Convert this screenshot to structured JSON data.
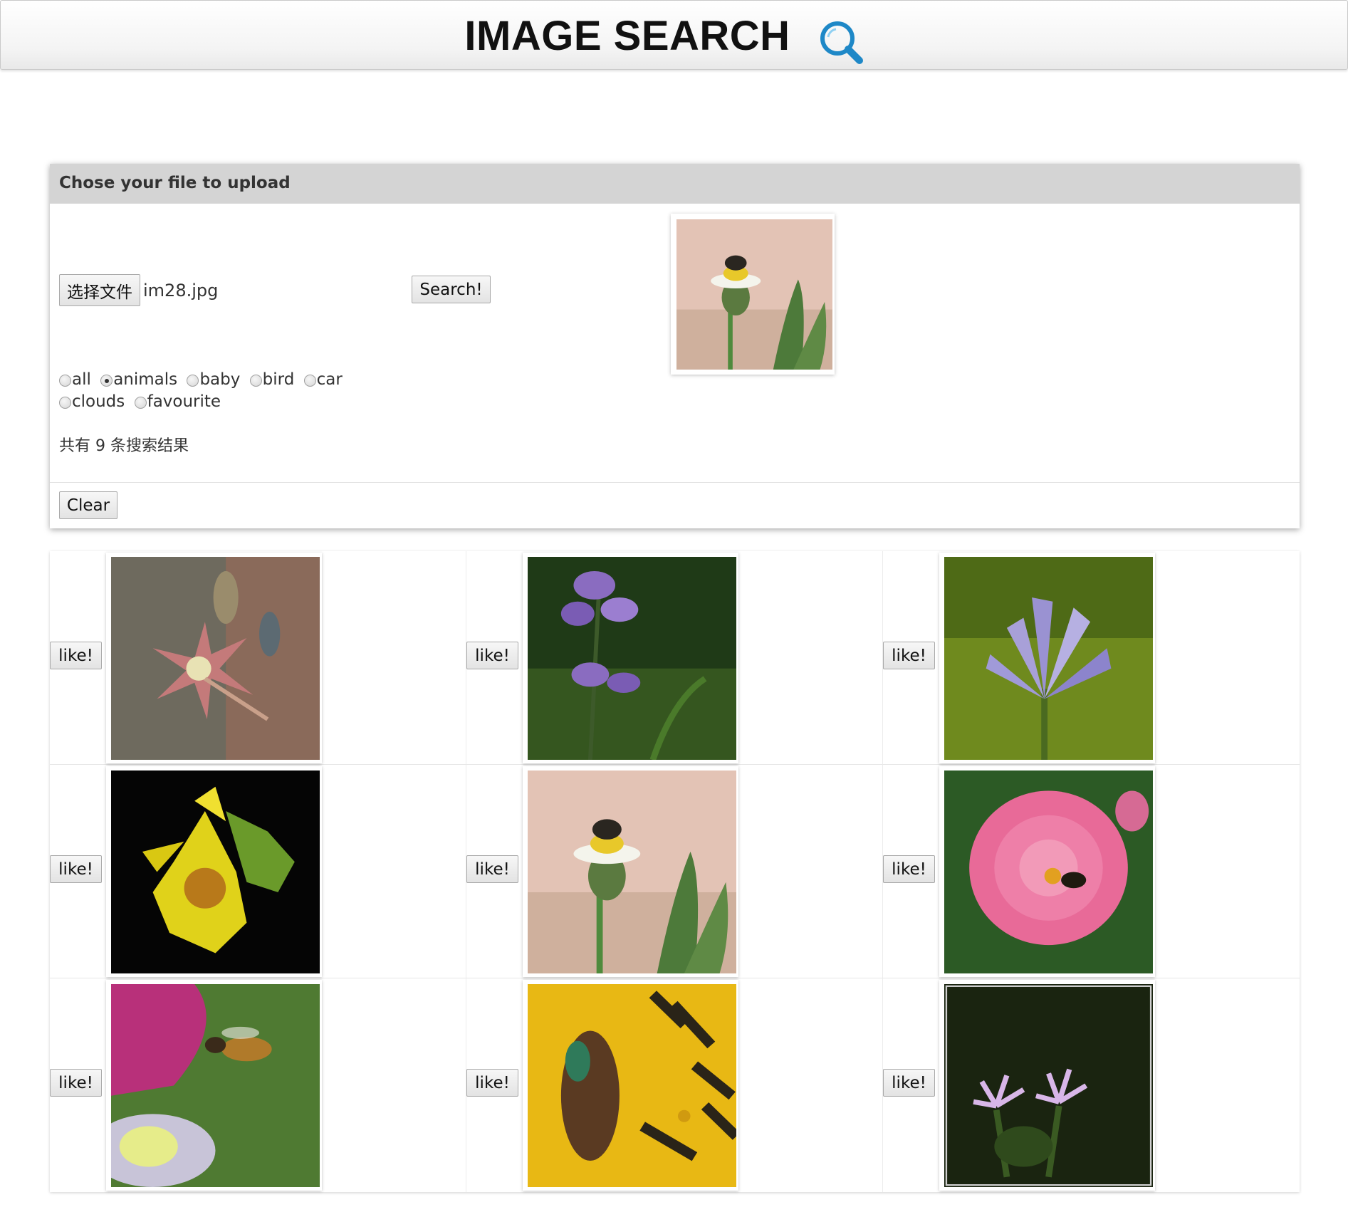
{
  "header": {
    "title": "IMAGE SEARCH",
    "icon": "search-icon",
    "icon_color": "#1e88c7"
  },
  "upload_panel": {
    "heading": "Chose your file to upload",
    "file_button_label": "选择文件",
    "file_name": "im28.jpg",
    "search_button_label": "Search!",
    "preview_image": "flower-with-bee",
    "categories": [
      {
        "label": "all",
        "checked": false
      },
      {
        "label": "animals",
        "checked": true
      },
      {
        "label": "baby",
        "checked": false
      },
      {
        "label": "bird",
        "checked": false
      },
      {
        "label": "car",
        "checked": false
      },
      {
        "label": "clouds",
        "checked": false
      },
      {
        "label": "favourite",
        "checked": false
      }
    ],
    "result_count_text": "共有 9 条搜索结果",
    "clear_button_label": "Clear"
  },
  "results": {
    "like_label": "like!",
    "images": [
      {
        "subject": "spotted-star-flower"
      },
      {
        "subject": "purple-bluebell"
      },
      {
        "subject": "lavender-lily"
      },
      {
        "subject": "yellow-sunflower"
      },
      {
        "subject": "flower-with-bee"
      },
      {
        "subject": "pink-dahlia-with-bee"
      },
      {
        "subject": "honeybee-on-flower"
      },
      {
        "subject": "beetle-in-yellow-flower"
      },
      {
        "subject": "purple-wildflower"
      }
    ]
  }
}
